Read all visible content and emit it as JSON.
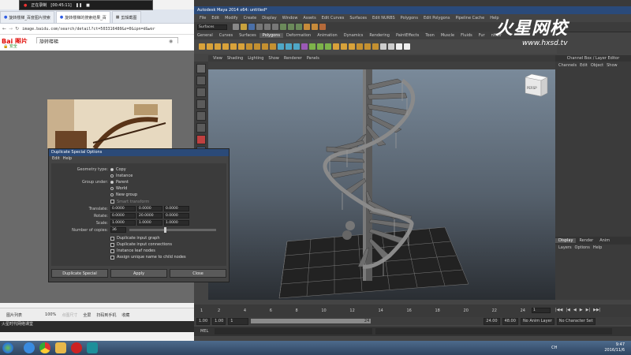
{
  "record_bar": {
    "status": "正在录制",
    "time": "[00:45:11]"
  },
  "browser": {
    "tabs": [
      {
        "label": "旋转楼梯_百度图片搜索",
        "active": false
      },
      {
        "label": "旋转楼梯的搜索结果_百",
        "active": true
      },
      {
        "label": "剪辑截图",
        "active": false
      }
    ],
    "url": "image.baidu.com/search/detail?ct=503316480&z=0&ipn=d&wor",
    "logo": "Bai 图片",
    "search_value": "旋转楼梯",
    "secure": "安全",
    "bottom_items": [
      "图片列表",
      "100%",
      "点图尺寸",
      "全屏",
      "扫码到手机",
      "收藏"
    ],
    "bottom_caption": "火星时代网络课堂"
  },
  "maya": {
    "title": "Autodesk Maya 2014 x64: untitled*",
    "menu": [
      "File",
      "Edit",
      "Modify",
      "Create",
      "Display",
      "Window",
      "Assets",
      "Edit Curves",
      "Surfaces",
      "Edit NURBS",
      "Polygons",
      "Edit Polygons",
      "Pipeline Cache",
      "Help"
    ],
    "mode": "Surfaces",
    "shelf_tabs": [
      "General",
      "Curves",
      "Surfaces",
      "Polygons",
      "Deformation",
      "Animation",
      "Dynamics",
      "Rendering",
      "PaintEffects",
      "Toon",
      "Muscle",
      "Fluids",
      "Fur",
      "nHair"
    ],
    "active_shelf": "Polygons",
    "panel_menu": [
      "View",
      "Shading",
      "Lighting",
      "Show",
      "Renderer",
      "Panels"
    ],
    "viewcube_label": "PERSP",
    "channel_box": {
      "title": "Channel Box / Layer Editor",
      "menu": [
        "Channels",
        "Edit",
        "Object",
        "Show"
      ]
    },
    "layer_tabs": [
      "Display",
      "Render",
      "Anim"
    ],
    "layer_menu": [
      "Layers",
      "Options",
      "Help"
    ],
    "timeline": {
      "start": "1",
      "ticks": [
        "2",
        "4",
        "6",
        "8",
        "10",
        "12",
        "14",
        "16",
        "18",
        "20",
        "22",
        "24"
      ],
      "current": "1"
    },
    "range": {
      "start": "1.00",
      "start2": "1.00",
      "current": "1",
      "end_inner": "24",
      "end": "24.00",
      "end2": "48.00",
      "anim_layer": "No Anim Layer",
      "char_set": "No Character Set"
    },
    "cmd_label": "MEL"
  },
  "dialog": {
    "title": "Duplicate Special Options",
    "menu": [
      "Edit",
      "Help"
    ],
    "geometry_type_label": "Geometry type:",
    "geometry_options": [
      "Copy",
      "Instance"
    ],
    "group_under_label": "Group under:",
    "group_options": [
      "Parent",
      "World",
      "New group"
    ],
    "smart_transform": "Smart transform",
    "translate_label": "Translate:",
    "translate": [
      "0.0000",
      "0.0000",
      "0.0000"
    ],
    "rotate_label": "Rotate:",
    "rotate": [
      "0.0000",
      "20.0000",
      "0.0000"
    ],
    "scale_label": "Scale:",
    "scale": [
      "1.0000",
      "1.0000",
      "1.0000"
    ],
    "copies_label": "Number of copies:",
    "copies": "36",
    "checkboxes": [
      "Duplicate input graph",
      "Duplicate input connections",
      "Instance leaf nodes",
      "Assign unique name to child nodes"
    ],
    "buttons": [
      "Duplicate Special",
      "Apply",
      "Close"
    ]
  },
  "watermark": {
    "brand": "火星网校",
    "site": "www.hxsd.tv"
  },
  "taskbar": {
    "lang": "CH",
    "time": "9:47",
    "date": "2016/11/6"
  }
}
